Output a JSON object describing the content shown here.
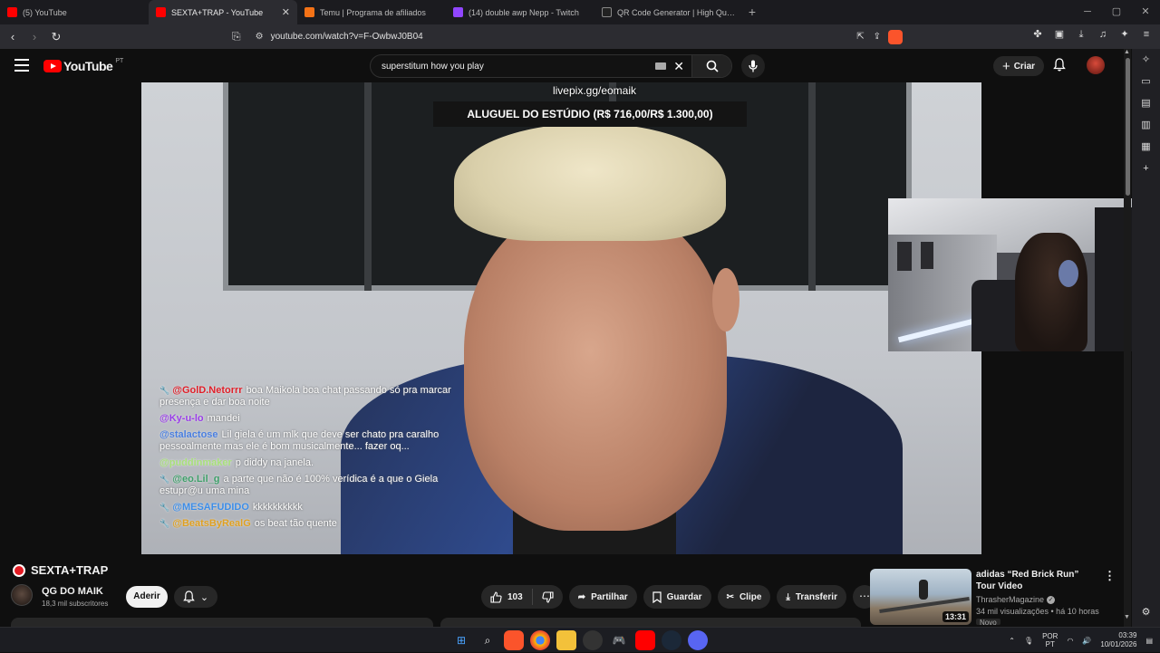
{
  "tabs": [
    {
      "label": "(5) YouTube",
      "fav_color": "#ff0000",
      "active": false
    },
    {
      "label": "SEXTA+TRAP - YouTube",
      "fav_color": "#ff0000",
      "active": true
    },
    {
      "label": "Temu | Programa de afiliados",
      "fav_color": "#f47216",
      "active": false
    },
    {
      "label": "(14) double awp Nepp - Twitch",
      "fav_color": "#9146ff",
      "active": false
    },
    {
      "label": "QR Code Generator | High Quality Fr",
      "fav_color": "#222222",
      "active": false
    }
  ],
  "new_tab": "+",
  "address": {
    "url": "youtube.com/watch?v=F-OwbwJ0B04"
  },
  "youtube": {
    "logo_text": "YouTube",
    "country": "PT",
    "search_query": "superstitum how you play",
    "create_label": "Criar"
  },
  "video": {
    "overlay_url": "livepix.gg/eomaik",
    "banner_text": "ALUGUEL DO ESTÚDIO (R$ 716,00/R$ 1.300,00)",
    "chat": [
      {
        "user": "@GolD.Netorrr",
        "color": "#e0202a",
        "text": "boa Maikola boa chat passando só pra marcar presença e dar boa noite",
        "badge": true
      },
      {
        "user": "@Ky-u-lo",
        "color": "#9a3ee8",
        "text": "mandei",
        "badge": false
      },
      {
        "user": "@stalactose",
        "color": "#4a7fe0",
        "text": "Lil giela é um mlk que deve ser chato pra caralho pessoalmente mas ele é bom musicalmente... fazer oq...",
        "badge": false
      },
      {
        "user": "@puddinmaker",
        "color": "#a8e07a",
        "text": "p diddy na janela.",
        "badge": false
      },
      {
        "user": "@eo.Lil_g",
        "color": "#3fa06a",
        "text": "a parte que não é 100% verídica é a que o Giela estupr@u uma mina",
        "badge": true
      },
      {
        "user": "@MESAFUDIDO",
        "color": "#3c8de8",
        "text": "kkkkkkkkkk",
        "badge": true
      },
      {
        "user": "@BeatsByRealG",
        "color": "#e0a020",
        "text": "os beat tão quente",
        "badge": true
      }
    ]
  },
  "below": {
    "title": "SEXTA+TRAP",
    "channel": "QG DO MAIK",
    "subscribers": "18,3 mil subscritores",
    "join_label": "Aderir",
    "likes": "103",
    "share_label": "Partilhar",
    "save_label": "Guardar",
    "clip_label": "Clipe",
    "download_label": "Transferir"
  },
  "recommendation": {
    "title": "adidas “Red Brick Run” Tour Video",
    "channel": "ThrasherMagazine",
    "meta": "34 mil visualizações • há 10 horas",
    "duration": "13:31",
    "badge": "Novo"
  },
  "taskbar": {
    "lang_top": "POR",
    "lang_bottom": "PT",
    "time": "03:39",
    "date": "10/01/2026"
  },
  "colors": {
    "accent": "#ff0000",
    "bg": "#0f0f0f",
    "brave": "#fb542b"
  }
}
